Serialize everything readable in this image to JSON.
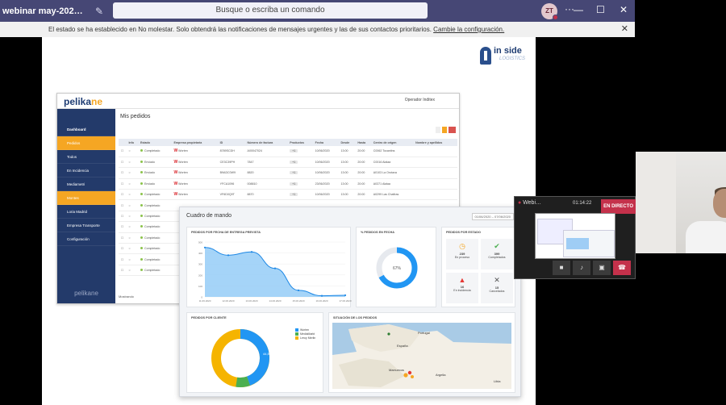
{
  "window": {
    "title": "webinar may-202…",
    "search_placeholder": "Busque o escriba un comando",
    "avatar_initials": "ZT",
    "more": "···",
    "minimize": "—",
    "maximize": "☐",
    "close": "✕"
  },
  "notification": {
    "text": "El estado se ha establecido en No molestar. Solo obtendrá las notificaciones de mensajes urgentes y las de sus contactos prioritarios.",
    "link": "Cambie la configuración.",
    "dismiss": "✕"
  },
  "slide": {
    "brand": {
      "word": "in side",
      "sub": "LOGISTICS"
    },
    "pelikane": {
      "logo_main": "pelika",
      "logo_accent": "ne",
      "operator": "Operador Inditex",
      "page_title": "Mis pedidos",
      "sidebar": [
        {
          "label": "Dashboard",
          "active": false
        },
        {
          "label": "Pedidos",
          "active": true
        },
        {
          "label": "Todos",
          "active": false
        },
        {
          "label": "En Incidencia",
          "active": false
        },
        {
          "label": "Mediametri",
          "active": false
        },
        {
          "label": "Montes",
          "active": true
        },
        {
          "label": "Loria Madrid",
          "active": false
        },
        {
          "label": "Empresa Transporte",
          "active": false
        },
        {
          "label": "Configuración",
          "active": false
        }
      ],
      "sidebar_footer": "pelikane",
      "columns": [
        "Info",
        "Estado",
        "Empresa propietaria",
        "ID",
        "Número de factura",
        "Productos",
        "Fecha",
        "Desde",
        "Hasta",
        "Centro de origen",
        "Nombre y apellidos"
      ],
      "rows": [
        {
          "estado": "Completado",
          "empresa": "Worten",
          "id": "8789SCDH",
          "factura": "A00047024",
          "productos": "+1",
          "fecha": "10/06/2020",
          "desde": "13:00",
          "hasta": "20:00",
          "centro": "C0062 Tocantins"
        },
        {
          "estado": "Enviado",
          "empresa": "Worten",
          "id": "CE3C39PH",
          "factura": "7847",
          "productos": "+1",
          "fecha": "10/06/2020",
          "desde": "13:00",
          "hasta": "20:00",
          "centro": "C0016 Alalaa"
        },
        {
          "estado": "Enviado",
          "empresa": "Worten",
          "id": "B9ADC0W9",
          "factura": "8820",
          "productos": "+1",
          "fecha": "10/06/2020",
          "desde": "13:00",
          "hasta": "20:00",
          "centro": "A0103 La Orotava"
        },
        {
          "estado": "Enviado",
          "empresa": "Worten",
          "id": "YFCA1096",
          "factura": "008810",
          "productos": "+1",
          "fecha": "23/06/2020",
          "desde": "13:00",
          "hasta": "20:00",
          "centro": "A0371 Alalaa"
        },
        {
          "estado": "Completado",
          "empresa": "Worten",
          "id": "VF6D0Q9T",
          "factura": "8870",
          "productos": "+1",
          "fecha": "10/06/2020",
          "desde": "13:00",
          "hasta": "20:00",
          "centro": "A0299 Las Chafiras"
        },
        {
          "estado": "Completado"
        },
        {
          "estado": "Completado"
        },
        {
          "estado": "Completado"
        },
        {
          "estado": "Completado"
        },
        {
          "estado": "Completado"
        },
        {
          "estado": "Completado"
        },
        {
          "estado": "Completado"
        }
      ],
      "pagination": "Mostrando"
    },
    "dashboard": {
      "title": "Cuadro de mando",
      "date_range": "01/06/2020 – 07/06/2020",
      "line_title": "PEDIDOS POR FECHA DE ENTREGA PREVISTA",
      "donut_pct_title": "% PEDIDOS EN FECHA",
      "donut_pct_value": "67%",
      "kpi_title": "PEDIDOS POR ESTADO",
      "kpis": [
        {
          "icon": "◷",
          "value": "239",
          "label": "En proceso",
          "color": "#f5a623"
        },
        {
          "icon": "✔",
          "value": "399",
          "label": "Completados",
          "color": "#4caf50"
        },
        {
          "icon": "▲",
          "value": "16",
          "label": "En incidencia",
          "color": "#e53935"
        },
        {
          "icon": "✕",
          "value": "15",
          "label": "Cancelados",
          "color": "#555555"
        }
      ],
      "client_title": "PEDIDOS POR CLIENTE",
      "client_legend": [
        {
          "name": "Worten",
          "color": "#2196f3"
        },
        {
          "name": "MediaMarkt",
          "color": "#4caf50"
        },
        {
          "name": "Leroy Merlin",
          "color": "#f5b400"
        }
      ],
      "client_pct": "44,5%",
      "map_title": "SITUACIÓN DE LOS PEDIDOS",
      "map_labels": [
        "Portugal",
        "España",
        "Marruecos",
        "Argelia",
        "Libia"
      ]
    }
  },
  "call": {
    "meeting_label": "Webi…",
    "timer": "01:14:22",
    "live": "EN DIRECTO"
  },
  "chart_data": {
    "type": "area",
    "title": "PEDIDOS POR FECHA DE ENTREGA PREVISTA",
    "categories": [
      "11.06.2020",
      "12.06.2020",
      "13.06.2020",
      "14.06.2020",
      "15.06.2020",
      "16.06.2020",
      "17.06.2020"
    ],
    "values": [
      450,
      380,
      410,
      260,
      60,
      10,
      15
    ],
    "ylim": [
      0,
      500
    ],
    "yticks": [
      0,
      100,
      200,
      300,
      400,
      500
    ]
  }
}
